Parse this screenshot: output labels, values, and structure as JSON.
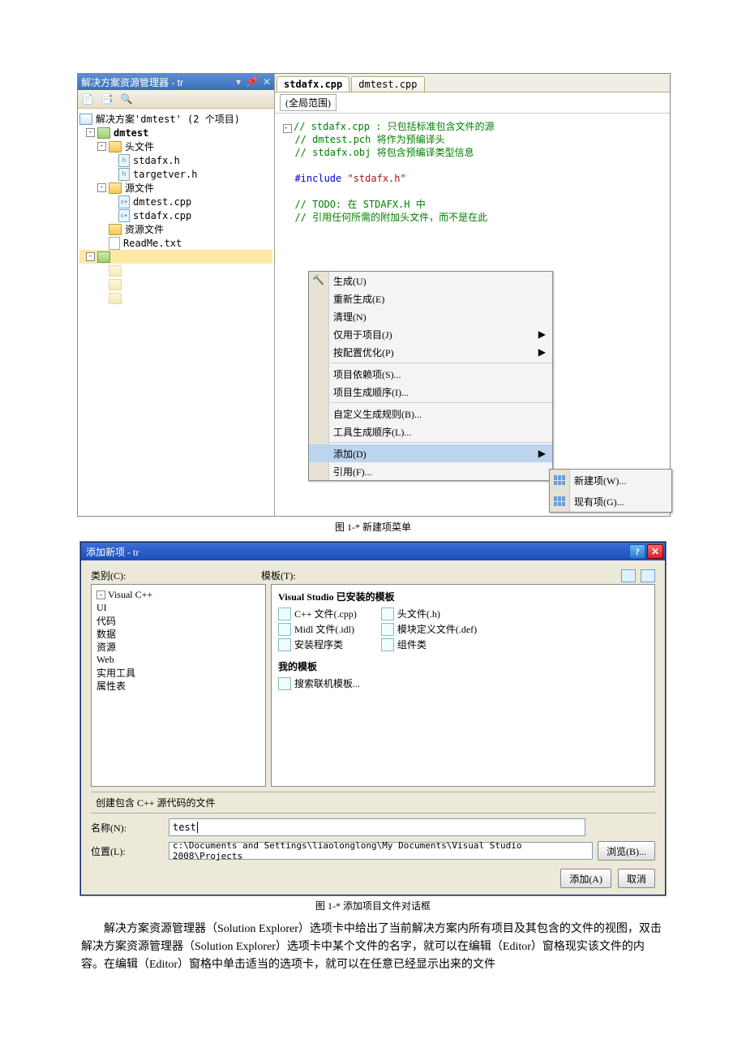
{
  "solutionPane": {
    "title": "解决方案资源管理器 - tr",
    "toolbarIcons": [
      "properties-icon",
      "show-all-icon",
      "view-code-icon"
    ],
    "tree": {
      "solution": "解决方案'dmtest' (2 个项目)",
      "proj1": "dmtest",
      "folder_headers": "头文件",
      "h1": "stdafx.h",
      "h2": "targetver.h",
      "folder_sources": "源文件",
      "s1": "dmtest.cpp",
      "s2": "stdafx.cpp",
      "folder_res": "资源文件",
      "readme": "ReadMe.txt"
    }
  },
  "editor": {
    "tab_active": "stdafx.cpp",
    "tab_other": "dmtest.cpp",
    "scope": "(全局范围)",
    "code": {
      "l1": "// stdafx.cpp : 只包括标准包含文件的源",
      "l2": "// dmtest.pch 将作为预编译头",
      "l3": "// stdafx.obj 将包含预编译类型信息",
      "l4a": "#include",
      "l4b": "\"stdafx.h\"",
      "l5": "// TODO: 在 STDAFX.H 中",
      "l6": "// 引用任何所需的附加头文件，而不是在此"
    }
  },
  "ctx": {
    "build": "生成(U)",
    "rebuild": "重新生成(E)",
    "clean": "清理(N)",
    "only": "仅用于项目(J)",
    "pgo": "按配置优化(P)",
    "deps": "项目依赖项(S)...",
    "order": "项目生成顺序(I)...",
    "custom": "自定义生成规则(B)...",
    "tool": "工具生成顺序(L)...",
    "add": "添加(D)",
    "ref": "引用(F)..."
  },
  "sub": {
    "new": "新建项(W)...",
    "exist": "现有项(G)..."
  },
  "caption1": "图 1-*  新建项菜单",
  "dialog": {
    "title": "添加新项 - tr",
    "cat_label": "类别(C):",
    "tmpl_label": "模板(T):",
    "cats": {
      "root": "Visual C++",
      "ui": "UI",
      "code": "代码",
      "data": "数据",
      "res": "资源",
      "web": "Web",
      "util": "实用工具",
      "prop": "属性表"
    },
    "tmpl_header": "Visual Studio 已安装的模板",
    "tmpl_items_left": {
      "cpp": "C++ 文件(.cpp)",
      "midl": "Midl 文件(.idl)",
      "installer": "安装程序类"
    },
    "tmpl_items_right": {
      "h": "头文件(.h)",
      "def": "模块定义文件(.def)",
      "comp": "组件类"
    },
    "my_tmpl": "我的模板",
    "search_online": "搜索联机模板...",
    "desc": "创建包含 C++ 源代码的文件",
    "name_lbl": "名称(N):",
    "name_val": "test",
    "loc_lbl": "位置(L):",
    "loc_val": "c:\\Documents and Settings\\liaolonglong\\My Documents\\Visual Studio 2008\\Projects",
    "browse": "浏览(B)...",
    "add": "添加(A)",
    "cancel": "取消"
  },
  "caption2": "图 1-*  添加项目文件对话框",
  "para": "解决方案资源管理器（Solution Explorer）选项卡中给出了当前解决方案内所有项目及其包含的文件的视图，双击解决方案资源管理器（Solution Explorer）选项卡中某个文件的名字，就可以在编辑（Editor）窗格现实该文件的内容。在编辑（Editor）窗格中单击适当的选项卡，就可以在任意已经显示出来的文件"
}
